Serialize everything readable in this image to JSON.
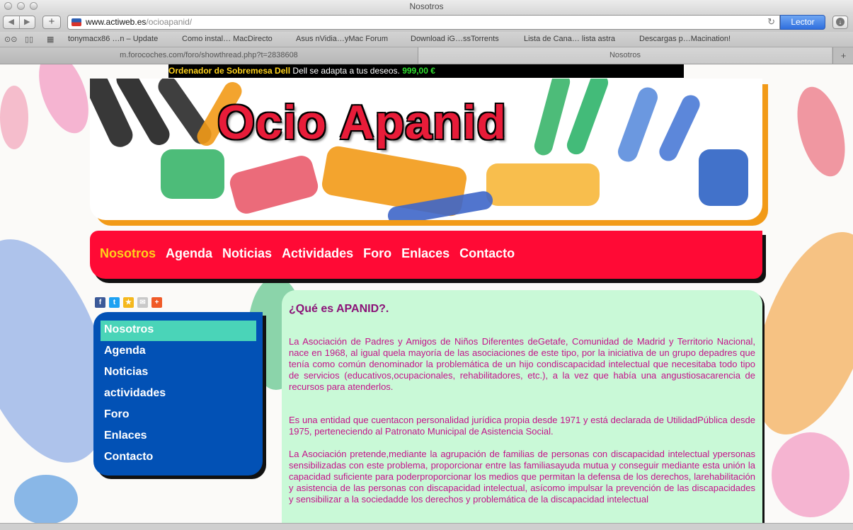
{
  "window": {
    "title": "Nosotros"
  },
  "toolbar": {
    "back": "◀",
    "forward": "▶",
    "new_tab": "+",
    "url_host": "www.actiweb.es",
    "url_path": "/ocioapanid/",
    "reload": "↻",
    "reader_label": "Lector",
    "download": "↓"
  },
  "bookmarks": {
    "items": [
      "tonymacx86 …n – Update",
      "Como instal… MacDirecto",
      "Asus nVidia…yMac Forum",
      "Download iG…ssTorrents",
      "Lista de Cana… lista astra",
      "Descargas p…Macination!"
    ]
  },
  "tabs": {
    "items": [
      {
        "label": "m.forocoches.com/foro/showthread.php?t=2838608"
      },
      {
        "label": "Nosotros"
      }
    ],
    "add": "+"
  },
  "ad": {
    "product": "Ordenador de Sobremesa Dell",
    "slogan": "Dell se adapta a tus deseos.",
    "price": "999,00 €"
  },
  "site": {
    "title": "Ocio Apanid"
  },
  "topnav": {
    "items": [
      "Nosotros",
      "Agenda",
      "Noticias",
      "Actividades",
      "Foro",
      "Enlaces",
      "Contacto"
    ]
  },
  "share": {
    "icons": [
      {
        "name": "facebook-icon",
        "glyph": "f",
        "color": "#3b5998"
      },
      {
        "name": "twitter-icon",
        "glyph": "t",
        "color": "#1da1f2"
      },
      {
        "name": "favorite-star-icon",
        "glyph": "★",
        "color": "#f5b81c"
      },
      {
        "name": "email-icon",
        "glyph": "✉",
        "color": "#c9c9c9"
      },
      {
        "name": "more-plus-icon",
        "glyph": "+",
        "color": "#f05a28"
      }
    ]
  },
  "sidebar": {
    "items": [
      "Nosotros",
      "Agenda",
      "Noticias",
      "actividades",
      "Foro",
      "Enlaces",
      "Contacto"
    ]
  },
  "content": {
    "heading": "¿Qué es APANID?.",
    "paragraphs": [
      "La Asociación de Padres y Amigos de Niños Diferentes deGetafe, Comunidad de Madrid y Territorio Nacional, nace en 1968, al igual quela mayoría de las asociaciones de este tipo, por la iniciativa de un grupo depadres que tenía como común denominador la problemática de un hijo condiscapacidad intelectual que necesitaba todo tipo de servicios (educativos,ocupacionales, rehabilitadores, etc.), a la vez que había una angustiosacarencia de recursos para atenderlos.",
      "Es una entidad que cuentacon personalidad jurídica propia desde 1971 y está declarada de UtilidadPública desde 1975, perteneciendo al Patronato Municipal de Asistencia Social.",
      "La Asociación pretende,mediante la agrupación de familias de personas con discapacidad intelectual ypersonas sensibilizadas con este problema, proporcionar entre las familiasayuda mutua y conseguir mediante esta unión la capacidad suficiente para poderproporcionar los medios que permitan la defensa de los derechos, larehabilitación y asistencia de las personas con discapacidad intelectual, asícomo impulsar la prevención de las discapacidades y sensibilizar a la sociedadde los derechos y problemática de la discapacidad intelectual"
    ]
  },
  "colors": {
    "nav_red": "#ff0a35",
    "nav_active": "#ffd21a",
    "sidebar_blue": "#0251b5",
    "sidebar_active": "#4ad4b8",
    "content_bg": "#c9f9d7",
    "content_text": "#c4138a",
    "heading_purple": "#8b1278",
    "banner_shadow": "#f29a17"
  }
}
